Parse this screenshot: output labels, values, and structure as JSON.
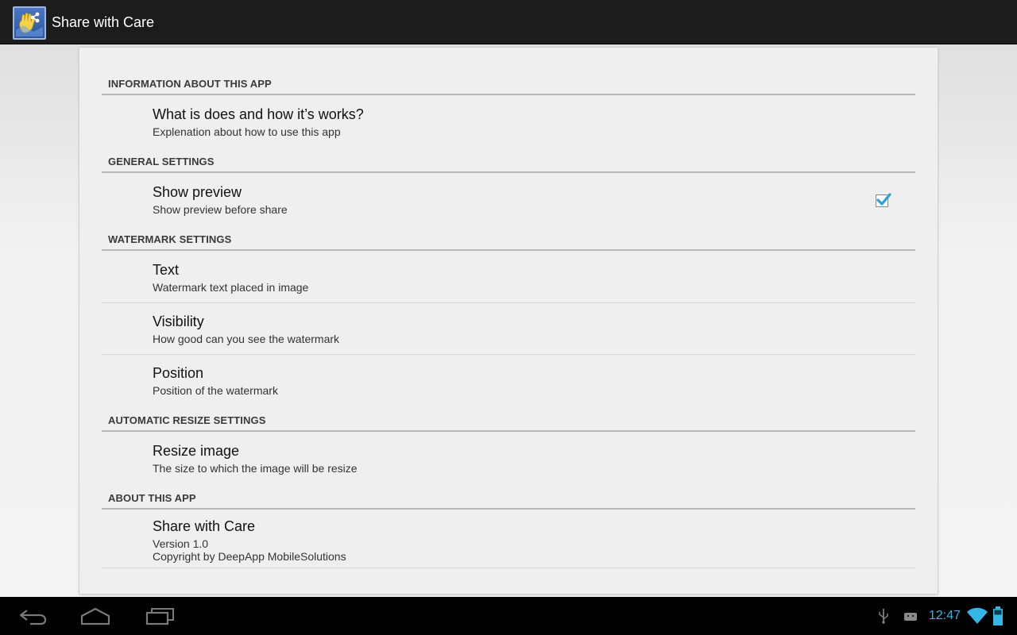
{
  "app": {
    "title": "Share with Care",
    "icon": "app-logo-icon",
    "accent": "#33b5e5"
  },
  "sections": [
    {
      "header": "INFORMATION ABOUT THIS APP"
    },
    {
      "header": "GENERAL SETTINGS"
    },
    {
      "header": "WATERMARK SETTINGS"
    },
    {
      "header": "AUTOMATIC RESIZE SETTINGS"
    },
    {
      "header": "ABOUT THIS APP"
    }
  ],
  "prefs": {
    "info": {
      "title": "What is does and how it’s works?",
      "summary": "Explenation about how to use this app"
    },
    "show_preview": {
      "title": "Show preview",
      "summary": "Show preview before share",
      "checked": true
    },
    "text": {
      "title": "Text",
      "summary": "Watermark text placed in image"
    },
    "visibility": {
      "title": "Visibility",
      "summary": "How good can you see the watermark"
    },
    "position": {
      "title": "Position",
      "summary": "Position of the watermark"
    },
    "resize": {
      "title": "Resize image",
      "summary": "The size to which the image will be resize"
    },
    "about": {
      "title": "Share with Care",
      "version": "Version 1.0",
      "copyright": "Copyright by DeepApp MobileSolutions"
    }
  },
  "system_bar": {
    "clock": "12:47",
    "icons": [
      "back-icon",
      "home-icon",
      "recent-apps-icon",
      "usb-icon",
      "android-debug-icon",
      "wifi-icon",
      "battery-icon"
    ]
  }
}
